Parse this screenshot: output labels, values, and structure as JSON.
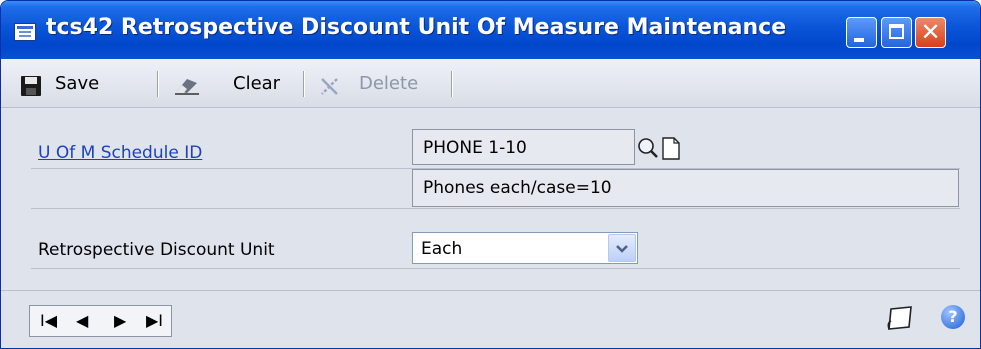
{
  "window": {
    "title": "tcs42 Retrospective Discount Unit Of Measure Maintenance",
    "close_glyph": "✕"
  },
  "toolbar": {
    "save_label": "Save",
    "clear_label": "Clear",
    "delete_label": "Delete"
  },
  "form": {
    "schedule_link": "U Of M Schedule ID",
    "schedule_id_value": "PHONE 1-10",
    "schedule_description": "Phones each/case=10",
    "discount_unit_label": "Retrospective Discount Unit",
    "discount_unit_value": "Each"
  },
  "navigation": {
    "first_glyph": "I◀",
    "prev_glyph": "◀",
    "next_glyph": "▶",
    "last_glyph": "▶I"
  },
  "help_glyph": "?"
}
